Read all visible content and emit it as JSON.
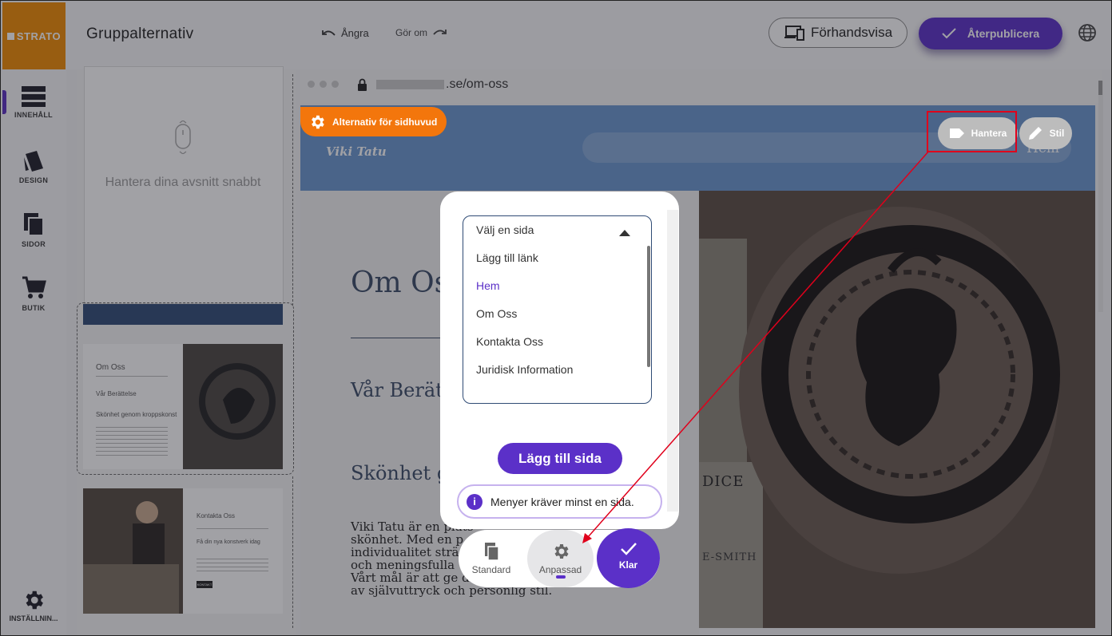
{
  "brand": {
    "logo": "STRATO",
    "color": "#f08a00"
  },
  "sidebar": {
    "items": [
      {
        "label": "INNEHÅLL",
        "icon": "content-icon"
      },
      {
        "label": "DESIGN",
        "icon": "design-icon"
      },
      {
        "label": "SIDOR",
        "icon": "pages-icon"
      },
      {
        "label": "BUTIK",
        "icon": "cart-icon"
      }
    ],
    "settings_label": "INSTÄLLNIN..."
  },
  "topbar": {
    "title": "Gruppalternativ",
    "undo": "Ångra",
    "redo": "Gör om",
    "preview": "Förhandsvisa",
    "publish": "Återpublicera",
    "accent": "#5b30c8"
  },
  "sections_panel": {
    "hint": "Hantera dina avsnitt snabbt",
    "thumb1": {
      "title": "Om Oss",
      "sub1": "Vår Berättelse",
      "sub2": "Skönhet genom kroppskonst"
    },
    "thumb2": {
      "title": "Kontakta Oss",
      "sub1": "Få din nya konstverk idag",
      "button": "KONTAKT"
    }
  },
  "browser": {
    "url_suffix": ".se/om-oss"
  },
  "site": {
    "brand": "Viki Tatu",
    "nav_item": "Hem",
    "header_options": "Alternativ för sidhuvud",
    "manage": "Hantera",
    "style": "Stil",
    "heading": "Om Oss",
    "subheading1": "Vår Berätt",
    "subheading2": "Skönhet g",
    "body_lines": [
      "Viki Tatu är en plats",
      "skönhet. Med en p",
      "individualitet strä",
      "och meningsfulla",
      "Vårt mål är att ge dig en oförglömlig upplevelse",
      "av självuttryck och personlig stil."
    ]
  },
  "modal": {
    "dropdown_label": "Välj en sida",
    "options": [
      "Lägg till länk",
      "Hem",
      "Om Oss",
      "Kontakta Oss",
      "Juridisk Information"
    ],
    "selected": "Hem",
    "add_button": "Lägg till sida",
    "info": "Menyer kräver minst en sida."
  },
  "bottom_toolbar": {
    "standard": "Standard",
    "custom": "Anpassad",
    "done": "Klar"
  },
  "photo_text": {
    "t1": "DICE",
    "t2": "E-SMITH"
  }
}
